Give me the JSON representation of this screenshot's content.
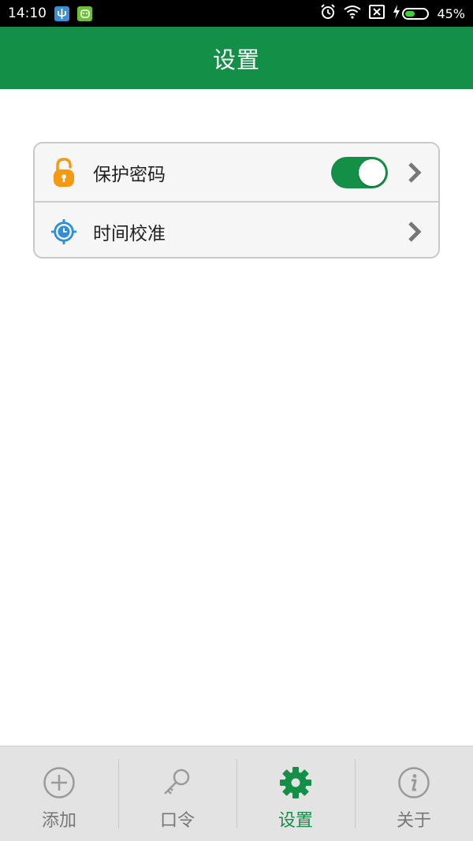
{
  "status_bar": {
    "time": "14:10",
    "battery_percent": "45%",
    "battery_level": 0.45,
    "icons": [
      "usb-icon",
      "android-icon",
      "alarm-icon",
      "wifi-icon",
      "no-sim-icon",
      "charging-icon",
      "battery-icon"
    ]
  },
  "header": {
    "title": "设置"
  },
  "settings": {
    "items": [
      {
        "label": "保护密码",
        "icon": "lock-icon",
        "toggle_on": true
      },
      {
        "label": "时间校准",
        "icon": "clock-target-icon"
      }
    ]
  },
  "bottom_nav": {
    "items": [
      {
        "label": "添加",
        "icon": "add-circle-icon"
      },
      {
        "label": "口令",
        "icon": "key-icon"
      },
      {
        "label": "设置",
        "icon": "gear-icon",
        "active": true
      },
      {
        "label": "关于",
        "icon": "info-icon"
      }
    ]
  },
  "colors": {
    "primary": "#138f47",
    "lock": "#f39a12",
    "clock": "#2f8fd8",
    "inactive": "#9a9a9a"
  }
}
